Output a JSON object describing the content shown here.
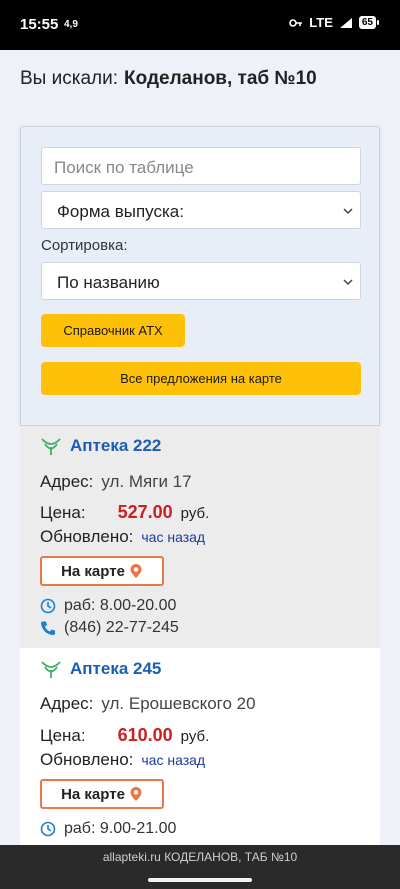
{
  "status": {
    "time": "15:55",
    "speed": "4,9",
    "network": "LTE",
    "battery": "65"
  },
  "search": {
    "prefix": "Вы искали:",
    "query": "Коделанов, таб №10"
  },
  "filters": {
    "search_placeholder": "Поиск по таблице",
    "form_select": "Форма выпуска:",
    "sort_label": "Сортировка:",
    "sort_select": "По названию",
    "atc_button": "Справочник АТХ",
    "map_all_button": "Все предложения на карте"
  },
  "pharmacies": [
    {
      "name": "Аптека 222",
      "address_label": "Адрес:",
      "address": "ул. Мяги 17",
      "price_label": "Цена:",
      "price": "527.00",
      "currency": "руб.",
      "updated_label": "Обновлено:",
      "updated": "час назад",
      "map_button": "На карте",
      "hours": "раб: 8.00-20.00",
      "phone": "(846) 22-77-245"
    },
    {
      "name": "Аптека 245",
      "address_label": "Адрес:",
      "address": "ул. Ерошевского 20",
      "price_label": "Цена:",
      "price": "610.00",
      "currency": "руб.",
      "updated_label": "Обновлено:",
      "updated": "час назад",
      "map_button": "На карте",
      "hours": "раб: 9.00-21.00",
      "phone": ""
    }
  ],
  "footer": {
    "url_title": "allapteki.ru КОДЕЛАНОВ, ТАБ №10"
  },
  "colors": {
    "accent_yellow": "#ffc107",
    "link_blue": "#1a5fb4",
    "price_red": "#cc1f1f",
    "map_orange": "#e8784a"
  }
}
